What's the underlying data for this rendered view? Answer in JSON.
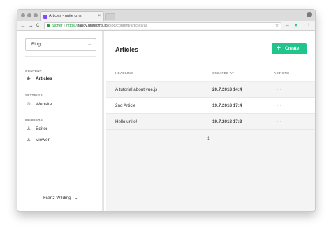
{
  "browser": {
    "tab_title": "Articles - unite cms",
    "tab_close": "×",
    "secure_label": "Sicher",
    "url_scheme": "https://",
    "url_host": "fancy.unitecms.io",
    "url_path": "/blog/content/articles/all",
    "back": "←",
    "forward": "→",
    "reload": "C",
    "star": "☆",
    "ext_icons": [
      "⇔",
      "▼",
      "⋮"
    ]
  },
  "sidebar": {
    "domain_select": "Blog",
    "sections": [
      {
        "title": "CONTENT",
        "items": [
          {
            "label": "Articles",
            "icon": "layers-icon",
            "glyph": "◈",
            "active": true
          }
        ]
      },
      {
        "title": "SETTINGS",
        "items": [
          {
            "label": "Website",
            "icon": "settings-icon",
            "glyph": "⊙",
            "active": false
          }
        ]
      },
      {
        "title": "MEMBERS",
        "items": [
          {
            "label": "Editor",
            "icon": "user-icon",
            "glyph": "♙",
            "active": false
          },
          {
            "label": "Viewer",
            "icon": "user-icon",
            "glyph": "♙",
            "active": false
          }
        ]
      }
    ],
    "user_name": "Franz Wilding",
    "user_chevron": "⌄"
  },
  "main": {
    "title": "Articles",
    "create_label": "Create",
    "create_plus": "+",
    "columns": {
      "headline": "HEADLINE",
      "created_at": "CREATED AT",
      "actions": "ACTIONS"
    },
    "rows": [
      {
        "headline": "A tutorial about vue.js",
        "created_at": "20.7.2018 14:4",
        "actions": "···"
      },
      {
        "headline": "2nd Article",
        "created_at": "19.7.2018 17:4",
        "actions": "···"
      },
      {
        "headline": "Hello unite!",
        "created_at": "19.7.2018 17:3",
        "actions": "···"
      }
    ],
    "page": "1"
  },
  "colors": {
    "accent": "#21c48a",
    "secure": "#1e9e3a"
  }
}
